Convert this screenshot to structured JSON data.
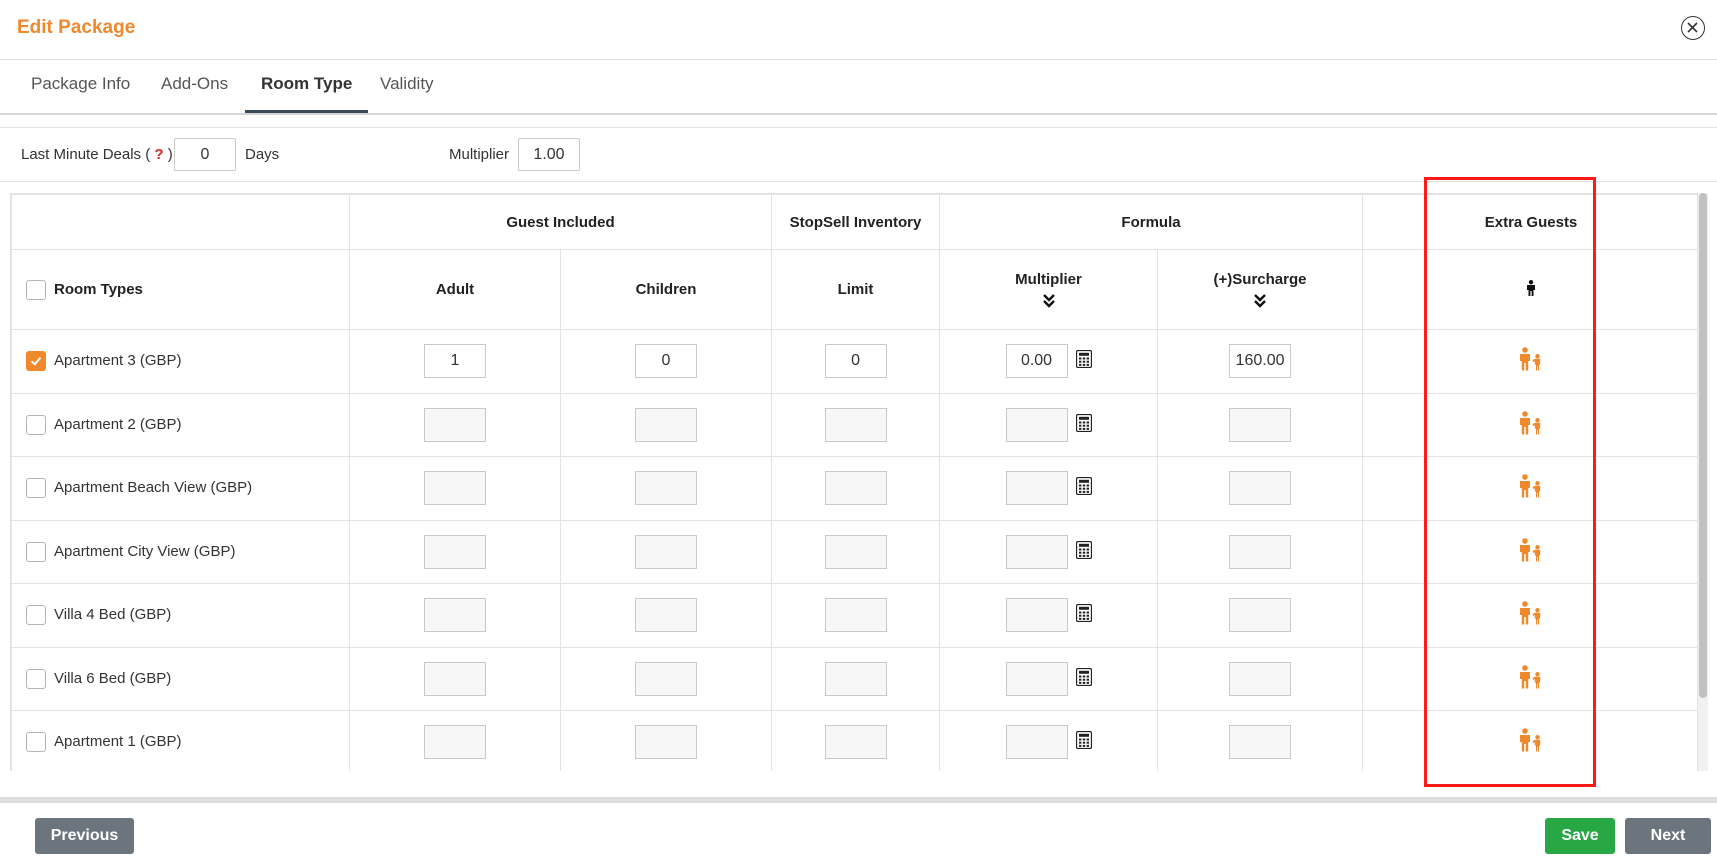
{
  "modal": {
    "title": "Edit Package"
  },
  "tabs": [
    {
      "label": "Package Info",
      "active": false
    },
    {
      "label": "Add-Ons",
      "active": false
    },
    {
      "label": "Room Type",
      "active": true
    },
    {
      "label": "Validity",
      "active": false
    }
  ],
  "deals": {
    "label_prefix": "Last Minute Deals (",
    "help_symbol": "?",
    "label_suffix": ")",
    "value": "0",
    "unit": "Days",
    "multiplier_label": "Multiplier",
    "multiplier_value": "1.00"
  },
  "table": {
    "group_headers": {
      "guest_included": "Guest Included",
      "stopsell_inventory": "StopSell Inventory",
      "formula": "Formula",
      "extra_guests": "Extra Guests"
    },
    "columns": {
      "room_types": "Room Types",
      "adult": "Adult",
      "children": "Children",
      "limit": "Limit",
      "multiplier": "Multiplier",
      "surcharge": "(+)Surcharge"
    },
    "rows": [
      {
        "name": "Apartment 3 (GBP)",
        "checked": true,
        "adult": "1",
        "children": "0",
        "limit": "0",
        "multiplier": "0.00",
        "surcharge": "160.00"
      },
      {
        "name": "Apartment 2 (GBP)",
        "checked": false,
        "adult": "",
        "children": "",
        "limit": "",
        "multiplier": "",
        "surcharge": ""
      },
      {
        "name": "Apartment Beach View (GBP)",
        "checked": false,
        "adult": "",
        "children": "",
        "limit": "",
        "multiplier": "",
        "surcharge": ""
      },
      {
        "name": "Apartment City View (GBP)",
        "checked": false,
        "adult": "",
        "children": "",
        "limit": "",
        "multiplier": "",
        "surcharge": ""
      },
      {
        "name": "Villa 4 Bed (GBP)",
        "checked": false,
        "adult": "",
        "children": "",
        "limit": "",
        "multiplier": "",
        "surcharge": ""
      },
      {
        "name": "Villa 6 Bed (GBP)",
        "checked": false,
        "adult": "",
        "children": "",
        "limit": "",
        "multiplier": "",
        "surcharge": ""
      },
      {
        "name": "Apartment 1 (GBP)",
        "checked": false,
        "adult": "",
        "children": "",
        "limit": "",
        "multiplier": "",
        "surcharge": ""
      }
    ]
  },
  "footer": {
    "previous": "Previous",
    "save": "Save",
    "next": "Next"
  },
  "colors": {
    "accent": "#f0882c",
    "save": "#28a745",
    "neutral": "#6c757d",
    "highlight": "#ff1a1a"
  },
  "icons": {
    "close": "close-circle-icon",
    "calculator": "calculator-icon",
    "extra_guest": "family-icon",
    "person": "person-icon",
    "expand": "double-chevron-down-icon"
  }
}
